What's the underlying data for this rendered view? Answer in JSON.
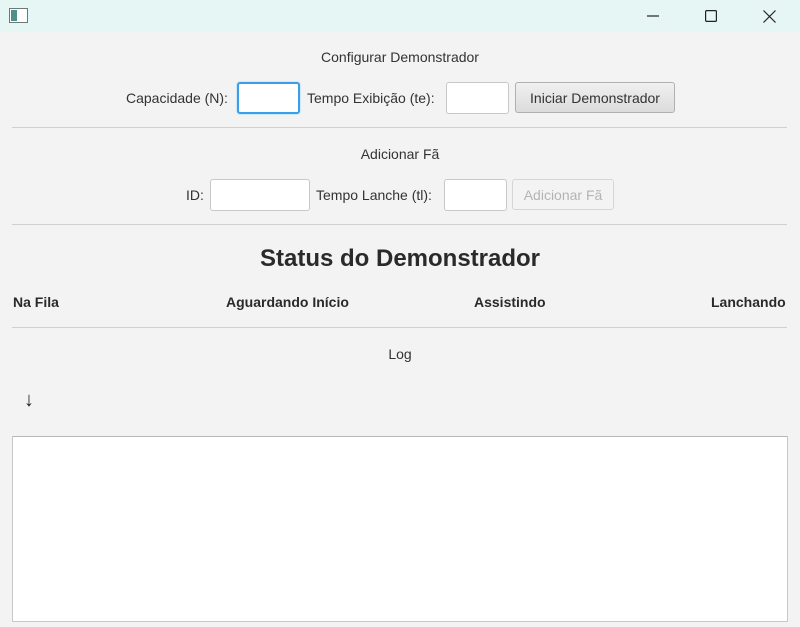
{
  "window": {
    "title": "",
    "controls": {
      "minimize": "minimize-icon",
      "maximize": "maximize-icon",
      "close": "close-icon"
    }
  },
  "config": {
    "heading": "Configurar Demonstrador",
    "capacity_label": "Capacidade (N):",
    "capacity_value": "",
    "time_label": "Tempo Exibição (te):",
    "time_value": "",
    "start_button": "Iniciar Demonstrador"
  },
  "add_fan": {
    "heading": "Adicionar Fã",
    "id_label": "ID:",
    "id_value": "",
    "snack_label": "Tempo Lanche (tl):",
    "snack_value": "",
    "add_button": "Adicionar Fã"
  },
  "status": {
    "title": "Status do Demonstrador",
    "columns": [
      "Na Fila",
      "Aguardando Início",
      "Assistindo",
      "Lanchando"
    ]
  },
  "log": {
    "heading": "Log",
    "scroll_icon": "↓",
    "content": ""
  },
  "colors": {
    "titlebar": "#e6f6f4",
    "focus": "#3a9fe6",
    "background": "#f3f3f3"
  }
}
